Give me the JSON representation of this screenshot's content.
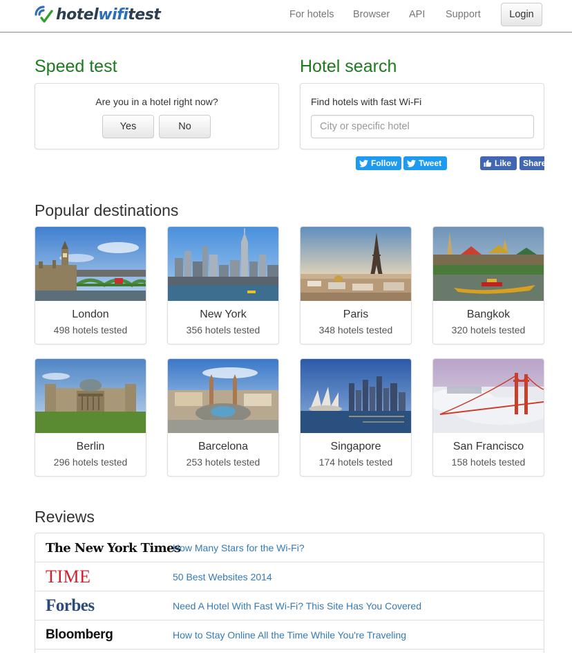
{
  "header": {
    "logo": {
      "part1": "hotel",
      "part2": "wifi",
      "part3": "test"
    },
    "nav": [
      "For hotels",
      "Browser",
      "API",
      "Support"
    ],
    "login_label": "Login"
  },
  "speed_test": {
    "title": "Speed test",
    "question": "Are you in a hotel right now?",
    "yes_label": "Yes",
    "no_label": "No"
  },
  "hotel_search": {
    "title": "Hotel search",
    "label": "Find hotels with fast Wi-Fi",
    "placeholder": "City or specific hotel",
    "value": ""
  },
  "social": {
    "follow_label": "Follow",
    "tweet_label": "Tweet",
    "like_label": "Like",
    "share_label": "Share"
  },
  "destinations": {
    "title": "Popular destinations",
    "items": [
      {
        "city": "London",
        "count": "498 hotels tested"
      },
      {
        "city": "New York",
        "count": "356 hotels tested"
      },
      {
        "city": "Paris",
        "count": "348 hotels tested"
      },
      {
        "city": "Bangkok",
        "count": "320 hotels tested"
      },
      {
        "city": "Berlin",
        "count": "296 hotels tested"
      },
      {
        "city": "Barcelona",
        "count": "253 hotels tested"
      },
      {
        "city": "Singapore",
        "count": "174 hotels tested"
      },
      {
        "city": "San Francisco",
        "count": "158 hotels tested"
      }
    ]
  },
  "reviews": {
    "title": "Reviews",
    "items": [
      {
        "source": "The New York Times",
        "headline": "How Many Stars for the Wi-Fi?"
      },
      {
        "source": "TIME",
        "headline": "50 Best Websites 2014"
      },
      {
        "source": "Forbes",
        "headline": "Need A Hotel With Fast Wi-Fi? This Site Has You Covered"
      },
      {
        "source": "Bloomberg",
        "headline": "How to Stay Online All the Time While You're Traveling"
      }
    ]
  },
  "colors": {
    "heading_green": "#1e7a1e",
    "link_blue": "#337ab7",
    "twitter_blue": "#1d9bf0",
    "facebook_blue": "#4267b2"
  },
  "icons": [
    "wifi-check-logo-icon",
    "twitter-bird-icon",
    "facebook-thumb-icon"
  ]
}
